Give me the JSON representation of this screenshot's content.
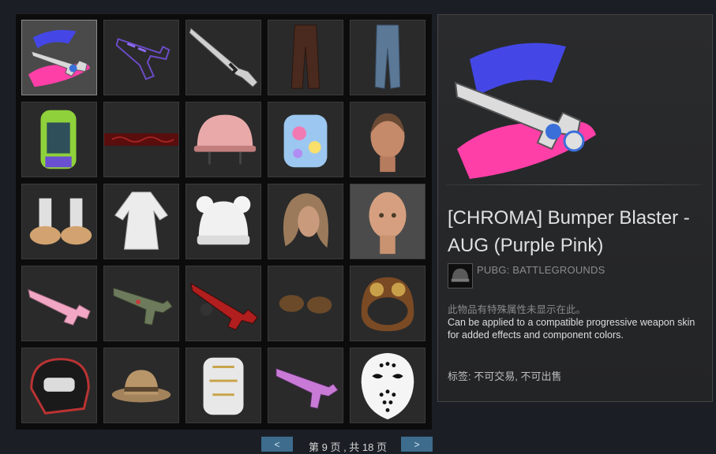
{
  "inventory": {
    "items": [
      {
        "icon": "chroma-aug-purple-pink-skin-icon"
      },
      {
        "icon": "purple-pistol-skin-icon"
      },
      {
        "icon": "shotgun-skin-icon"
      },
      {
        "icon": "brown-pants-icon"
      },
      {
        "icon": "blue-jeans-icon"
      },
      {
        "icon": "green-patterned-backpack-icon"
      },
      {
        "icon": "red-belt-icon"
      },
      {
        "icon": "pink-helmet-icon"
      },
      {
        "icon": "pastel-backpack-icon"
      },
      {
        "icon": "female-face-icon"
      },
      {
        "icon": "white-socks-clogs-icon"
      },
      {
        "icon": "white-dress-icon"
      },
      {
        "icon": "white-bear-beanie-icon"
      },
      {
        "icon": "wavy-blonde-hair-icon"
      },
      {
        "icon": "bald-female-head-icon"
      },
      {
        "icon": "pink-aug-skin-icon"
      },
      {
        "icon": "green-smg-skin-icon"
      },
      {
        "icon": "red-rifle-skin-icon"
      },
      {
        "icon": "animal-paw-gloves-icon"
      },
      {
        "icon": "leather-goggle-helmet-icon"
      },
      {
        "icon": "motocross-helmet-icon"
      },
      {
        "icon": "bucket-hat-icon"
      },
      {
        "icon": "white-gold-backpack-icon"
      },
      {
        "icon": "purple-smg-skin-icon"
      },
      {
        "icon": "hockey-mask-icon"
      }
    ]
  },
  "pager": {
    "prev_label": "<",
    "next_label": ">",
    "page_text": "第 9 页 , 共 18 页"
  },
  "detail": {
    "image_icon": "chroma-aug-purple-pink-skin-icon",
    "name": "[CHROMA] Bumper Blaster - AUG (Purple Pink)",
    "game_icon": "pubg-helmet-icon",
    "game": "PUBG: BATTLEGROUNDS",
    "note": "此物品有特殊属性未显示在此。",
    "description": "Can be applied to a compatible progressive weapon skin for added effects and component colors.",
    "tags": "标签: 不可交易, 不可出售"
  },
  "colors": {
    "accent_blue": "#3d6c8d",
    "chroma_pink": "#ff3fa8",
    "chroma_blue": "#4447e6"
  }
}
